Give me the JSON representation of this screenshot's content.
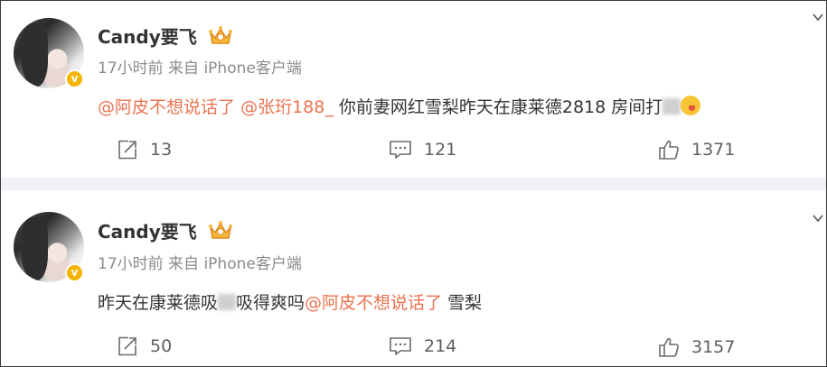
{
  "colors": {
    "mention": "#eb7350",
    "text": "#333333",
    "meta": "#8b8b8b",
    "separator": "#f1f2f5",
    "badge": "#f5b400"
  },
  "posts": [
    {
      "user": {
        "name": "Candy要飞",
        "avatar_icon": "avatar-photo",
        "badge_icon": "verified-v-icon",
        "crown_icon": "vip-crown-icon"
      },
      "time": "17小时前",
      "source": "来自 iPhone客户端",
      "content": {
        "mention1": "@阿皮不想说话了",
        "mention2": "@张珩188_",
        "text1": "你前妻网红雪梨昨天在康莱德2818 房间打"
      },
      "actions": {
        "repost": "13",
        "comment": "121",
        "like": "1371"
      }
    },
    {
      "user": {
        "name": "Candy要飞",
        "avatar_icon": "avatar-photo",
        "badge_icon": "verified-v-icon",
        "crown_icon": "vip-crown-icon"
      },
      "time": "17小时前",
      "source": "来自 iPhone客户端",
      "content": {
        "text1": "昨天在康莱德吸",
        "text2": "吸得爽吗",
        "mention1": "@阿皮不想说话了",
        "text3": "雪梨"
      },
      "actions": {
        "repost": "50",
        "comment": "214",
        "like": "3157"
      }
    }
  ]
}
